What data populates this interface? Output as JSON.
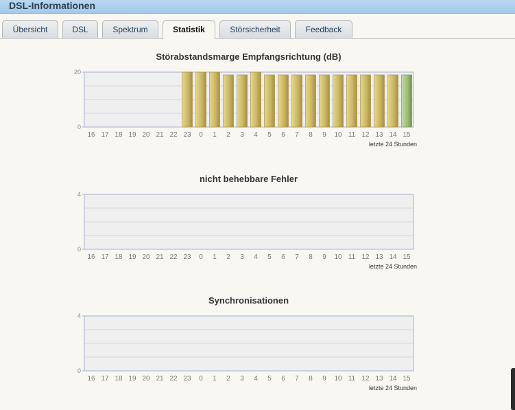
{
  "header": {
    "title": "DSL-Informationen"
  },
  "tabs": [
    {
      "label": "Übersicht",
      "active": false
    },
    {
      "label": "DSL",
      "active": false
    },
    {
      "label": "Spektrum",
      "active": false
    },
    {
      "label": "Statistik",
      "active": true
    },
    {
      "label": "Störsicherheit",
      "active": false
    },
    {
      "label": "Feedback",
      "active": false
    }
  ],
  "colors": {
    "bar": "#c8b463",
    "bar_current": "#9dbb78",
    "plot_bg": "#efefef",
    "axis": "#a8b0cc",
    "header_bg": "#a3c8ea"
  },
  "chart_data": [
    {
      "type": "bar",
      "title": "Störabstandsmarge Empfangsrichtung (dB)",
      "xlabel": "letzte 24 Stunden",
      "ylabel": "",
      "ylim": [
        0,
        20
      ],
      "yticks": [
        "0",
        "20"
      ],
      "categories": [
        "16",
        "17",
        "18",
        "19",
        "20",
        "21",
        "22",
        "23",
        "0",
        "1",
        "2",
        "3",
        "4",
        "5",
        "6",
        "7",
        "8",
        "9",
        "10",
        "11",
        "12",
        "13",
        "14",
        "15"
      ],
      "values": [
        null,
        null,
        null,
        null,
        null,
        null,
        null,
        20,
        20,
        20,
        19,
        19,
        20,
        19,
        19,
        19,
        19,
        19,
        19,
        19,
        19,
        19,
        19,
        19
      ],
      "grid": true
    },
    {
      "type": "bar",
      "title": "nicht behebbare Fehler",
      "xlabel": "letzte 24 Stunden",
      "ylabel": "",
      "ylim": [
        0,
        4
      ],
      "yticks": [
        "0",
        "4"
      ],
      "categories": [
        "16",
        "17",
        "18",
        "19",
        "20",
        "21",
        "22",
        "23",
        "0",
        "1",
        "2",
        "3",
        "4",
        "5",
        "6",
        "7",
        "8",
        "9",
        "10",
        "11",
        "12",
        "13",
        "14",
        "15"
      ],
      "values": [
        0,
        0,
        0,
        0,
        0,
        0,
        0,
        0,
        0,
        0,
        0,
        0,
        0,
        0,
        0,
        0,
        0,
        0,
        0,
        0,
        0,
        0,
        0,
        0
      ],
      "grid": true
    },
    {
      "type": "bar",
      "title": "Synchronisationen",
      "xlabel": "letzte 24 Stunden",
      "ylabel": "",
      "ylim": [
        0,
        4
      ],
      "yticks": [
        "0",
        "4"
      ],
      "categories": [
        "16",
        "17",
        "18",
        "19",
        "20",
        "21",
        "22",
        "23",
        "0",
        "1",
        "2",
        "3",
        "4",
        "5",
        "6",
        "7",
        "8",
        "9",
        "10",
        "11",
        "12",
        "13",
        "14",
        "15"
      ],
      "values": [
        0,
        0,
        0,
        0,
        0,
        0,
        0,
        0,
        0,
        0,
        0,
        0,
        0,
        0,
        0,
        0,
        0,
        0,
        0,
        0,
        0,
        0,
        0,
        0
      ],
      "grid": true
    }
  ]
}
